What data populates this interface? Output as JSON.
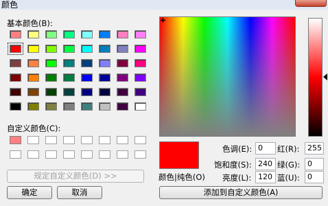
{
  "window": {
    "title": "颜色"
  },
  "basic_colors": {
    "label": "基本颜色(B):",
    "rows": [
      [
        "#ff8080",
        "#ffff80",
        "#80ff80",
        "#00ff80",
        "#80ffff",
        "#0080ff",
        "#ff80c0",
        "#ff80ff"
      ],
      [
        "#ff0000",
        "#ffff00",
        "#80ff00",
        "#00ff40",
        "#00ffff",
        "#0080c0",
        "#8080c0",
        "#ff00ff"
      ],
      [
        "#804040",
        "#ff8040",
        "#00ff00",
        "#008080",
        "#004080",
        "#8080ff",
        "#800040",
        "#ff0080"
      ],
      [
        "#800000",
        "#ff8000",
        "#008000",
        "#008040",
        "#0000ff",
        "#0000a0",
        "#800080",
        "#8000ff"
      ],
      [
        "#400000",
        "#804000",
        "#004000",
        "#004040",
        "#000080",
        "#000040",
        "#400040",
        "#400080"
      ],
      [
        "#000000",
        "#808000",
        "#808040",
        "#808080",
        "#408080",
        "#c0c0c0",
        "#400040",
        "#ffffff"
      ]
    ]
  },
  "custom_colors": {
    "label": "自定义颜色(C):",
    "first": "#ff8080"
  },
  "buttons": {
    "define_custom": "规定自定义颜色(D) >>",
    "ok": "确定",
    "cancel": "取消",
    "add_custom": "添加到自定义颜色(A)"
  },
  "preview": {
    "label": "颜色|纯色(O)",
    "color": "#ff0000"
  },
  "fields": {
    "hue_label": "色调(E):",
    "hue": "0",
    "sat_label": "饱和度(S):",
    "sat": "240",
    "lum_label": "亮度(L):",
    "lum": "120",
    "red_label": "红(R):",
    "red": "255",
    "green_label": "绿(G):",
    "green": "0",
    "blue_label": "蓝(U):",
    "blue": "0"
  }
}
